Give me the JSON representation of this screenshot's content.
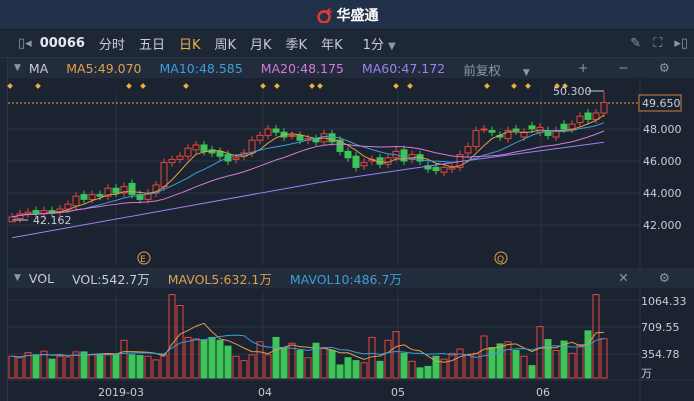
{
  "app": {
    "title": "华盛通"
  },
  "toolbar": {
    "code": "00066",
    "tabs": [
      "分时",
      "五日",
      "日K",
      "周K",
      "月K",
      "季K",
      "年K"
    ],
    "active": "日K",
    "interval": "1分"
  },
  "ma_bar": {
    "label": "MA",
    "ma5": "MA5:49.070",
    "ma10": "MA10:48.585",
    "ma20": "MA20:48.175",
    "ma60": "MA60:47.172",
    "adjust": "前复权"
  },
  "vol_bar": {
    "label": "VOL",
    "vol": "VOL:542.7万",
    "mavol5": "MAVOL5:632.1万",
    "mavol10": "MAVOL10:486.7万"
  },
  "colors": {
    "up": "#e8453c",
    "down": "#3ec55a",
    "ma5": "#e0a04a",
    "ma10": "#3aa0d8",
    "ma20": "#d878d8",
    "ma60": "#9a82f0",
    "bg": "#1b2230"
  },
  "price_axis": {
    "ticks": [
      "48.000",
      "46.000",
      "44.000",
      "42.000"
    ],
    "current": "49.650",
    "high_label": "50.300",
    "low_label": "42.162"
  },
  "vol_axis": {
    "ticks": [
      "1064.33",
      "709.55",
      "354.78"
    ],
    "unit": "万"
  },
  "date_axis": [
    "2019-03",
    "04",
    "05",
    "06"
  ],
  "markers": {
    "E": "E",
    "Q": "Q"
  },
  "chart_data": {
    "type": "candlestick",
    "ylim": [
      40.8,
      50.6
    ],
    "closes": [
      42.5,
      42.7,
      42.8,
      42.7,
      42.9,
      42.8,
      43.0,
      43.3,
      43.8,
      43.6,
      43.9,
      43.8,
      44.3,
      44.0,
      44.4,
      43.9,
      43.6,
      44.0,
      44.5,
      45.9,
      46.1,
      46.3,
      46.8,
      47.0,
      46.6,
      46.5,
      46.3,
      46.0,
      46.2,
      46.5,
      47.3,
      47.6,
      48.0,
      47.8,
      47.5,
      47.6,
      47.3,
      47.4,
      47.2,
      47.7,
      47.2,
      46.6,
      46.2,
      45.6,
      45.9,
      46.1,
      45.8,
      46.2,
      46.6,
      46.0,
      46.4,
      46.0,
      45.5,
      45.4,
      45.6,
      45.6,
      46.4,
      46.9,
      47.9,
      48.0,
      47.8,
      47.5,
      47.9,
      47.9,
      47.8,
      48.0,
      48.1,
      47.6,
      47.9,
      48.0,
      48.3,
      48.8,
      48.6,
      49.0,
      49.65
    ],
    "opens": [
      42.2,
      42.4,
      42.7,
      42.9,
      42.7,
      42.9,
      42.8,
      43.0,
      43.2,
      43.9,
      43.6,
      43.9,
      43.8,
      44.3,
      44.0,
      44.6,
      43.9,
      43.6,
      44.0,
      44.4,
      45.9,
      46.1,
      46.3,
      46.7,
      47.0,
      46.7,
      46.6,
      46.4,
      46.1,
      46.3,
      46.5,
      47.3,
      47.6,
      48.0,
      47.8,
      47.6,
      47.6,
      47.3,
      47.4,
      47.2,
      47.7,
      47.3,
      46.6,
      46.3,
      45.7,
      46.0,
      46.2,
      45.8,
      46.2,
      46.7,
      46.1,
      46.4,
      45.7,
      45.6,
      45.3,
      45.5,
      45.6,
      46.5,
      46.9,
      48.0,
      47.9,
      47.6,
      47.4,
      48.0,
      47.5,
      48.2,
      47.8,
      47.9,
      47.5,
      48.3,
      48.0,
      48.4,
      49.0,
      48.6,
      49.0
    ],
    "highs_pad": 0.25,
    "high_index": 74,
    "high": 50.3,
    "low_index": 0,
    "low": 42.162,
    "ma60": [
      [
        0,
        41.2
      ],
      [
        20,
        43.0
      ],
      [
        40,
        44.8
      ],
      [
        55,
        45.9
      ],
      [
        74,
        47.17
      ]
    ],
    "volumes": [
      300,
      280,
      350,
      320,
      370,
      260,
      300,
      290,
      360,
      360,
      320,
      330,
      320,
      330,
      520,
      320,
      310,
      300,
      250,
      320,
      1150,
      1000,
      560,
      540,
      520,
      560,
      520,
      440,
      300,
      240,
      320,
      500,
      320,
      560,
      420,
      480,
      380,
      280,
      480,
      420,
      380,
      180,
      280,
      240,
      210,
      560,
      230,
      520,
      640,
      340,
      230,
      140,
      160,
      300,
      260,
      340,
      400,
      320,
      340,
      580,
      420,
      470,
      500,
      380,
      300,
      170,
      710,
      530,
      380,
      510,
      340,
      460,
      650,
      1150,
      542.7
    ],
    "vol_ylim": [
      0,
      1200
    ]
  }
}
